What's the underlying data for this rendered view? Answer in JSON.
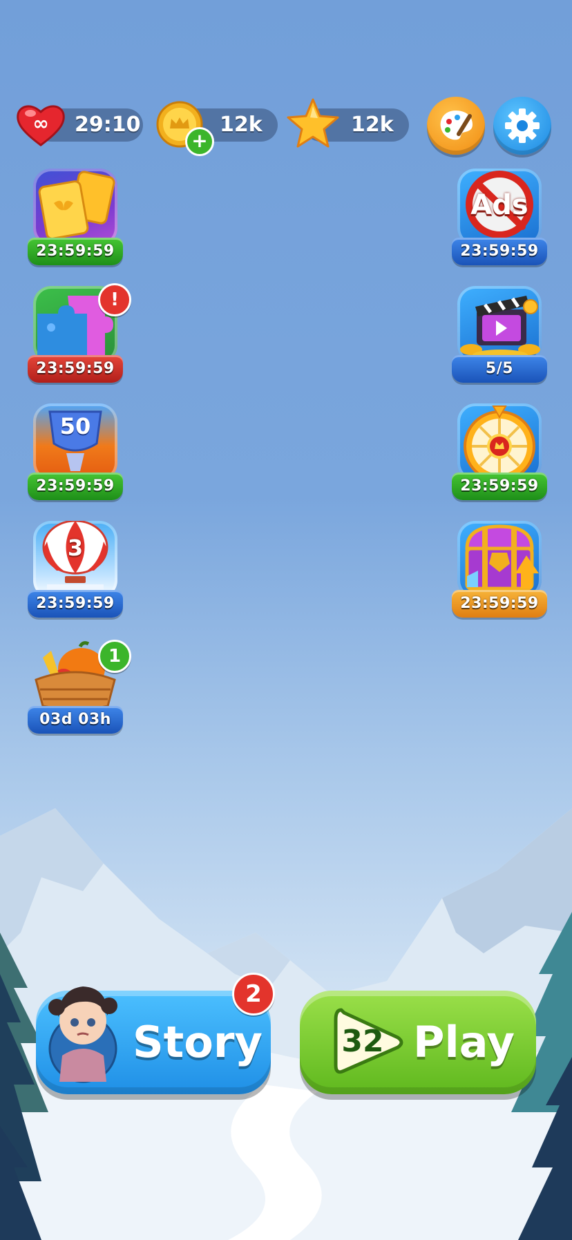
{
  "top_bar": {
    "lives_value": "29:10",
    "coins_value": "12k",
    "stars_value": "12k"
  },
  "left_events": [
    {
      "name": "card-collection",
      "timer": "23:59:59"
    },
    {
      "name": "puzzle",
      "timer": "23:59:59",
      "badge": "!"
    },
    {
      "name": "trophy-race",
      "timer": "23:59:59",
      "art_label": "50"
    },
    {
      "name": "balloon",
      "timer": "23:59:59",
      "art_label": "3"
    },
    {
      "name": "harvest-basket",
      "timer": "03d 03h",
      "badge": "1"
    }
  ],
  "right_events": [
    {
      "name": "remove-ads",
      "timer": "23:59:59",
      "art_label": "Ads"
    },
    {
      "name": "video-rewards",
      "timer": "5/5"
    },
    {
      "name": "lucky-wheel",
      "timer": "23:59:59"
    },
    {
      "name": "treasure-chest",
      "timer": "23:59:59"
    }
  ],
  "story_button": {
    "label": "Story",
    "badge": "2"
  },
  "play_button": {
    "label": "Play",
    "level": "32"
  },
  "colors": {
    "story": "#2f9ef0",
    "play": "#7ccc2a",
    "lives": "#e5262e",
    "settings": "#2aa0ef"
  }
}
